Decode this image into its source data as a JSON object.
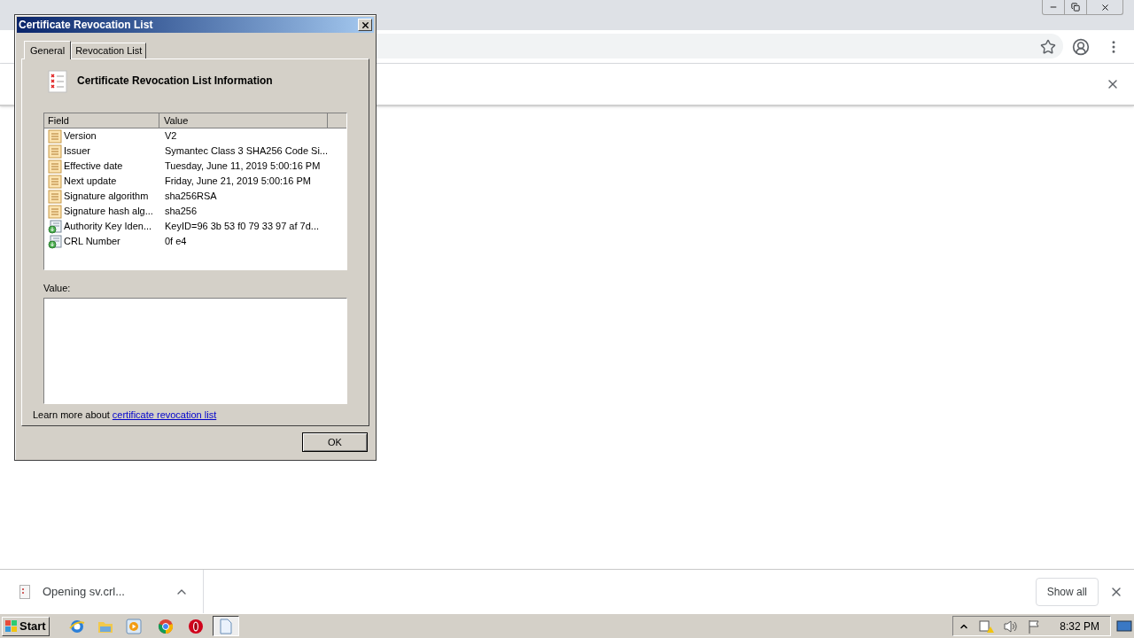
{
  "dialog": {
    "title": "Certificate Revocation List",
    "tabs": [
      {
        "label": "General",
        "selected": true
      },
      {
        "label": "Revocation List",
        "selected": false
      }
    ],
    "heading": "Certificate Revocation List Information",
    "columns": [
      "Field",
      "Value"
    ],
    "rows": [
      {
        "kind": "property",
        "field": "Version",
        "value": "V2"
      },
      {
        "kind": "property",
        "field": "Issuer",
        "value": "Symantec Class 3 SHA256 Code Si..."
      },
      {
        "kind": "property",
        "field": "Effective date",
        "value": "Tuesday, June 11, 2019 5:00:16 PM"
      },
      {
        "kind": "property",
        "field": "Next update",
        "value": "Friday, June 21, 2019 5:00:16 PM"
      },
      {
        "kind": "property",
        "field": "Signature algorithm",
        "value": "sha256RSA"
      },
      {
        "kind": "property",
        "field": "Signature hash alg...",
        "value": "sha256"
      },
      {
        "kind": "extension",
        "field": "Authority Key Iden...",
        "value": "KeyID=96 3b 53 f0 79 33 97 af 7d..."
      },
      {
        "kind": "extension",
        "field": "CRL Number",
        "value": "0f e4"
      }
    ],
    "value_label": "Value:",
    "learn_more": {
      "text": "Learn more about",
      "link": "certificate revocation list"
    },
    "buttons": [
      "OK"
    ]
  },
  "download_shelf": {
    "item": "Opening sv.crl...",
    "show_all": "Show all"
  },
  "taskbar": {
    "start": "Start",
    "quick_launch": [
      {
        "kind": "ie"
      },
      {
        "kind": "folder"
      },
      {
        "kind": "media"
      }
    ],
    "tasks": [
      {
        "kind": "chrome",
        "selected": false
      },
      {
        "kind": "opera",
        "selected": false
      },
      {
        "kind": "document",
        "selected": true
      }
    ],
    "clock": "8:32 PM"
  }
}
